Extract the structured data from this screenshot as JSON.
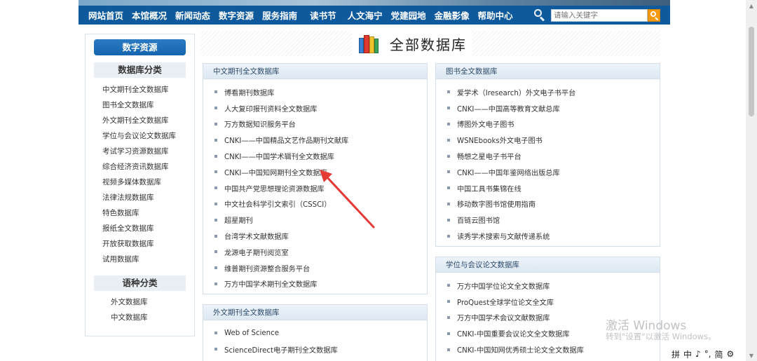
{
  "nav": {
    "items": [
      "网站首页",
      "本馆概况",
      "新闻动态",
      "数字资源",
      "服务指南",
      "读书节",
      "人文海宁",
      "党建园地",
      "金融影像",
      "帮助中心"
    ],
    "search_placeholder": "请输入关键字"
  },
  "sidebar": {
    "header": "数字资源",
    "db_category_title": "数据库分类",
    "db_categories": [
      "中文期刊全文数据库",
      "图书全文数据库",
      "外文期刊全文数据库",
      "学位与会议论文数据库",
      "考试学习资源数据库",
      "综合经济资讯数据库",
      "视频多媒体数据库",
      "法律法规数据库",
      "特色数据库",
      "报纸全文数据库",
      "开放获取数据库",
      "试用数据库"
    ],
    "lang_category_title": "语种分类",
    "lang_categories": [
      "外文数据库",
      "中文数据库"
    ]
  },
  "main": {
    "title": "全部数据库",
    "panels": {
      "cn_journals": {
        "title": "中文期刊全文数据库",
        "items": [
          "博看期刊数据库",
          "人大复印报刊资料全文数据库",
          "万方数据知识服务平台",
          "CNKI——中国精品文艺作品期刊文献库",
          "CNKI——中国学术辑刊全文数据库",
          "CNKI—中国知网期刊全文数据库",
          "中国共产党思想理论资源数据库",
          "中文社会科学引文索引（CSSCI）",
          "超星期刊",
          "台湾学术文献数据库",
          "龙源电子期刊阅览室",
          "维普期刊资源整合服务平台",
          "万方中国学术期刊全文数据库"
        ]
      },
      "books": {
        "title": "图书全文数据库",
        "items": [
          "爱学术（Iresearch）外文电子书平台",
          "CNKI——中国高等教育文献总库",
          "博图外文电子图书",
          "WSNEbooks外文电子图书",
          "畅想之星电子书平台",
          "CNKI——中国年鉴网络出版总库",
          "中国工具书集锦在线",
          "移动数字图书馆使用指南",
          "百链云图书馆",
          "读秀学术搜索与文献传递系统"
        ]
      },
      "foreign_journals": {
        "title": "外文期刊全文数据库",
        "items": [
          "Web of Science",
          "ScienceDirect电子期刊全文数据库"
        ]
      },
      "theses": {
        "title": "学位与会议论文数据库",
        "items": [
          "万方中国学位论文全文数据库",
          "ProQuest全球学位论文全文库",
          "万方中国学术会议文献数据库",
          "CNKI-中国重要会议论文全文数据库",
          "CNKI-中国知网优秀硕士论文全文数据库"
        ]
      }
    }
  },
  "watermark": {
    "line1": "激活 Windows",
    "line2": "转到\"设置\"以激活 Windows。"
  },
  "ime": [
    "拼",
    "中",
    "♪",
    "°,",
    "简",
    "⚙"
  ],
  "colors": {
    "nav_bg": "#0f5a9c",
    "search_button": "#f29b12",
    "arrow": "#e53935"
  }
}
